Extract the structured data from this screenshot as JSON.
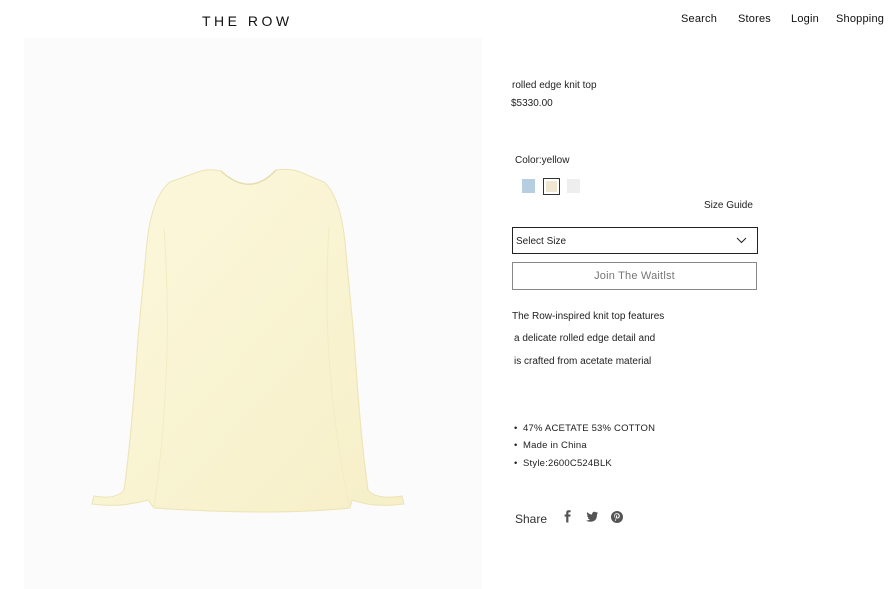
{
  "header": {
    "brand": "THE ROW",
    "nav": [
      "Search",
      "Stores",
      "Login",
      "Shopping"
    ]
  },
  "product": {
    "title": "rolled edge knit top",
    "price": "$5330.00",
    "color_label": "Color:yellow",
    "swatches": [
      {
        "name": "light-blue",
        "color": "#b7cde0",
        "selected": false
      },
      {
        "name": "yellow",
        "color": "#efe7d2",
        "selected": true
      },
      {
        "name": "white",
        "color": "#eeeeee",
        "selected": false
      }
    ],
    "size_guide": "Size Guide",
    "size_select": "Select Size",
    "waitlist_button": "Join  The Waitlst",
    "description": [
      "The Row-inspired knit top features",
      "a delicate rolled edge detail and",
      "is crafted from acetate material"
    ],
    "details": [
      "47% ACETATE 53% COTTON",
      "Made in China",
      "Style:2600C524BLK"
    ],
    "share_label": "Share",
    "share_icons": [
      "facebook-icon",
      "twitter-icon",
      "pinterest-icon"
    ]
  },
  "colors": {
    "sweater": "#fbf6d6",
    "accent": "#222222"
  }
}
